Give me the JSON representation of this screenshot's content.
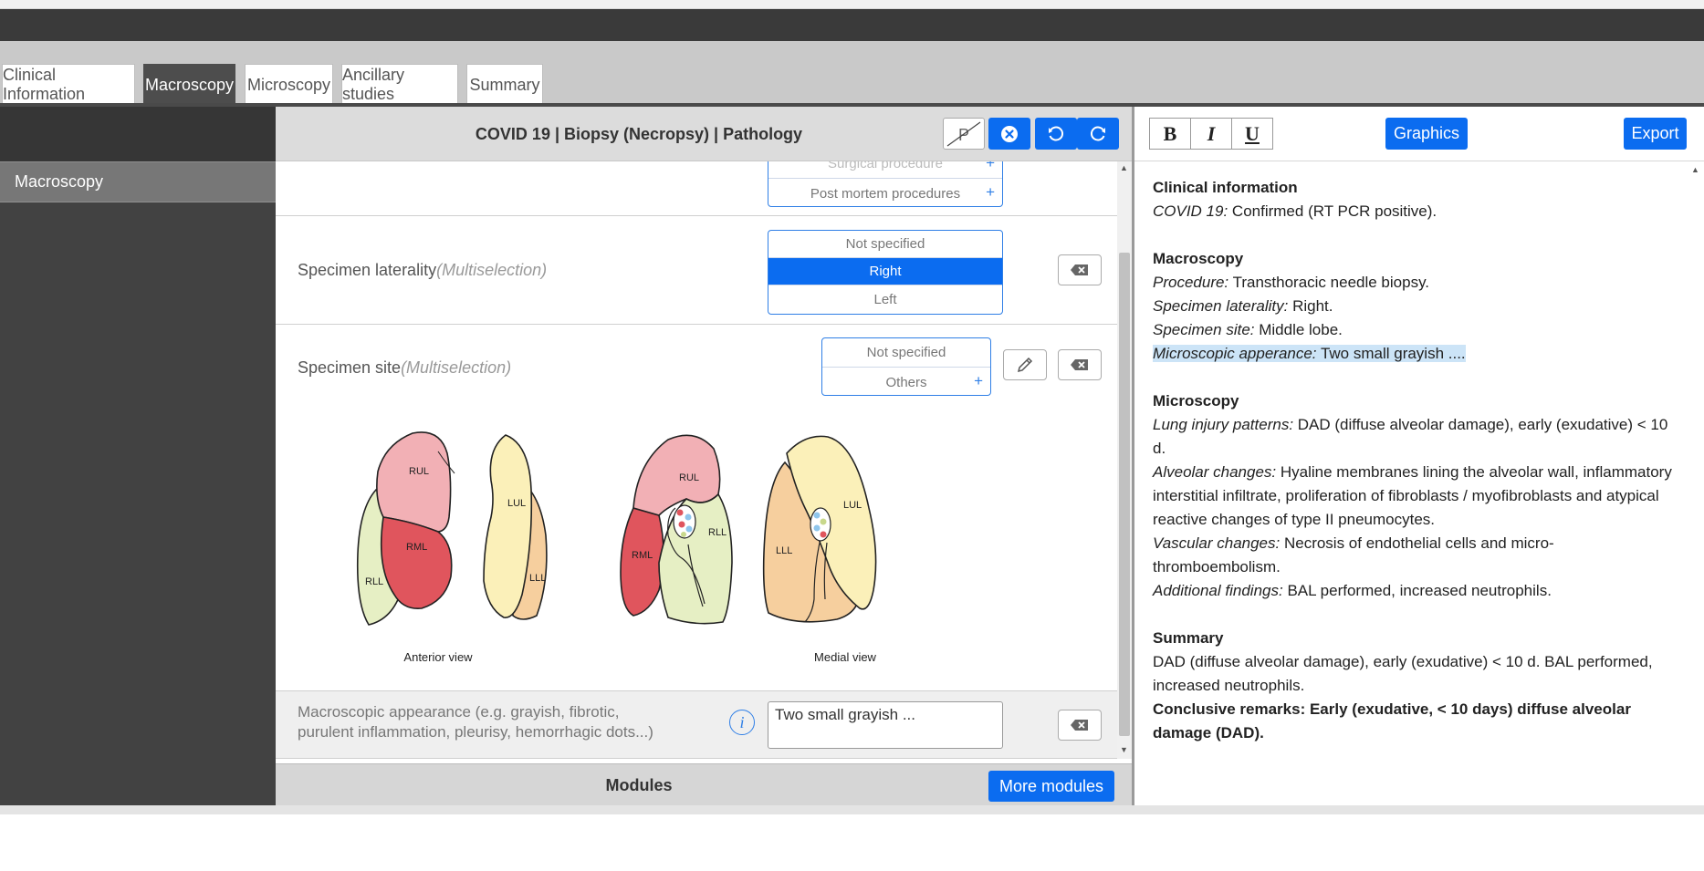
{
  "tabs": [
    {
      "label": "Clinical Information",
      "active": false
    },
    {
      "label": "Macroscopy",
      "active": true
    },
    {
      "label": "Microscopy",
      "active": false
    },
    {
      "label": "Ancillary studies",
      "active": false
    },
    {
      "label": "Summary",
      "active": false
    }
  ],
  "sidebar": {
    "items": [
      {
        "label": "Macroscopy",
        "active": true
      }
    ]
  },
  "center": {
    "title": "COVID 19 | Biopsy (Necropsy) | Pathology",
    "procedure_options": [
      "Surgical procedure",
      "Post mortem procedures"
    ],
    "laterality": {
      "label": "Specimen laterality",
      "hint": "(Multiselection)",
      "options": [
        "Not specified",
        "Right",
        "Left"
      ],
      "selected": "Right"
    },
    "site": {
      "label": "Specimen site",
      "hint": "(Multiselection)",
      "options": [
        "Not specified",
        "Others"
      ]
    },
    "diagram": {
      "anterior_caption": "Anterior view",
      "medial_caption": "Medial view",
      "labels": {
        "rul": "RUL",
        "rml": "RML",
        "rll": "RLL",
        "lul": "LUL",
        "lll": "LLL"
      },
      "colors": {
        "rul": "#f2b0b5",
        "rml": "#e0555d",
        "rll": "#e6efc4",
        "lul": "#fbf0b9",
        "lll": "#f6cf9e"
      }
    },
    "appearance": {
      "label": "Macroscopic appearance (e.g. grayish, fibrotic, purulent inflammation, pleurisy, hemorrhagic dots...)",
      "value": "Two small grayish ..."
    },
    "modules_label": "Modules",
    "more_modules": "More modules"
  },
  "right": {
    "format_buttons": [
      "B",
      "I",
      "U"
    ],
    "graphics": "Graphics",
    "export": "Export",
    "report": {
      "clinical_heading": "Clinical information",
      "covid_key": "COVID 19:",
      "covid_val": " Confirmed (RT PCR positive).",
      "macro_heading": "Macroscopy",
      "procedure_key": "Procedure:",
      "procedure_val": " Transthoracic needle biopsy.",
      "laterality_key": "Specimen laterality:",
      "laterality_val": " Right.",
      "site_key": "Specimen site:",
      "site_val": " Middle lobe.",
      "appearance_key": "Microscopic apperance:",
      "appearance_val": " Two small grayish ....",
      "micro_heading": "Microscopy",
      "lung_key": "Lung injury patterns:",
      "lung_val": " DAD (diffuse alveolar damage), early (exudative) < 10 d.",
      "alveolar_key": "Alveolar changes:",
      "alveolar_val": " Hyaline membranes lining the alveolar wall, inflammatory interstitial infiltrate, proliferation of fibroblasts / myofibroblasts and atypical reactive changes of type II pneumocytes.",
      "vascular_key": "Vascular changes:",
      "vascular_val": " Necrosis of endothelial cells and micro-thromboembolism.",
      "additional_key": "Additional findings:",
      "additional_val": " BAL performed, increased neutrophils.",
      "summary_heading": "Summary",
      "summary_text": "DAD (diffuse alveolar damage), early (exudative) < 10 d. BAL performed, increased neutrophils.",
      "conclusive": "Conclusive remarks: Early (exudative, < 10 days) diffuse alveolar damage (DAD)."
    }
  },
  "colors": {
    "accent": "#0b6cf0",
    "dark": "#424242",
    "tabbar": "#c9c9c9"
  }
}
